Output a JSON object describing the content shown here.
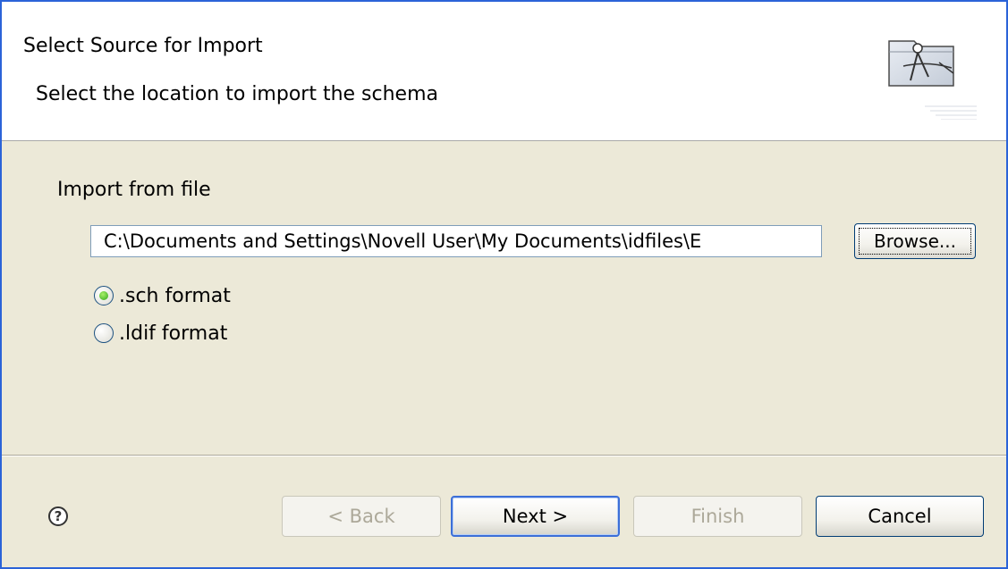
{
  "header": {
    "title": "Select Source for Import",
    "description": "Select the location to import the schema",
    "icon": "wizard-import-icon"
  },
  "content": {
    "group_label": "Import from file",
    "path_value": "C:\\Documents and Settings\\Novell User\\My Documents\\idfiles\\E",
    "browse_label": "Browse...",
    "radios": [
      {
        "label": ".sch format",
        "checked": true
      },
      {
        "label": ".ldif format",
        "checked": false
      }
    ]
  },
  "footer": {
    "help_icon": "question-icon",
    "help_glyph": "?",
    "back_label": "< Back",
    "next_label": "Next >",
    "finish_label": "Finish",
    "cancel_label": "Cancel"
  },
  "colors": {
    "accent": "#2b63d8",
    "dialog_bg": "#ece9d8",
    "radio_checked": "#2fa61b"
  }
}
